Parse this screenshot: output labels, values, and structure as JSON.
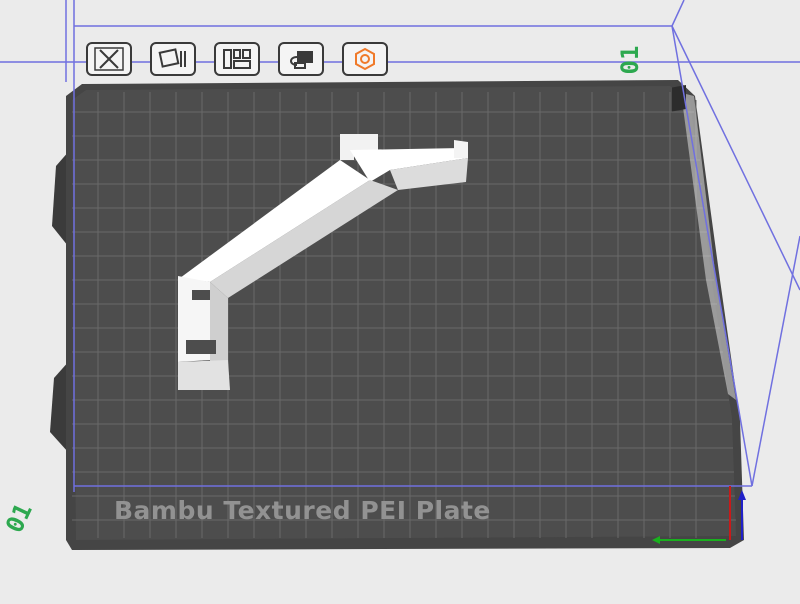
{
  "plate": {
    "label": "Bambu Textured PEI Plate",
    "number": "01",
    "left_number": "01"
  },
  "toolbar": {
    "buttons": [
      {
        "name": "delete-plate-button",
        "icon": "close-icon"
      },
      {
        "name": "orient-button",
        "icon": "orient-icon"
      },
      {
        "name": "arrange-button",
        "icon": "arrange-icon"
      },
      {
        "name": "lock-button",
        "icon": "lock-icon"
      },
      {
        "name": "plate-settings-button",
        "icon": "gear-hex-icon"
      }
    ]
  },
  "colors": {
    "background": "#ebebeb",
    "bed": "#4a4a4a",
    "grid": "#6c6c6c",
    "bounding_box": "#7070e0",
    "plate_number": "#2da84f",
    "label_text": "#929292",
    "settings_accent": "#f07a2a",
    "model": "#f2f2f2",
    "axis_x": "#19b01e",
    "axis_y": "#2020c8",
    "axis_z": "#c81a1a"
  }
}
